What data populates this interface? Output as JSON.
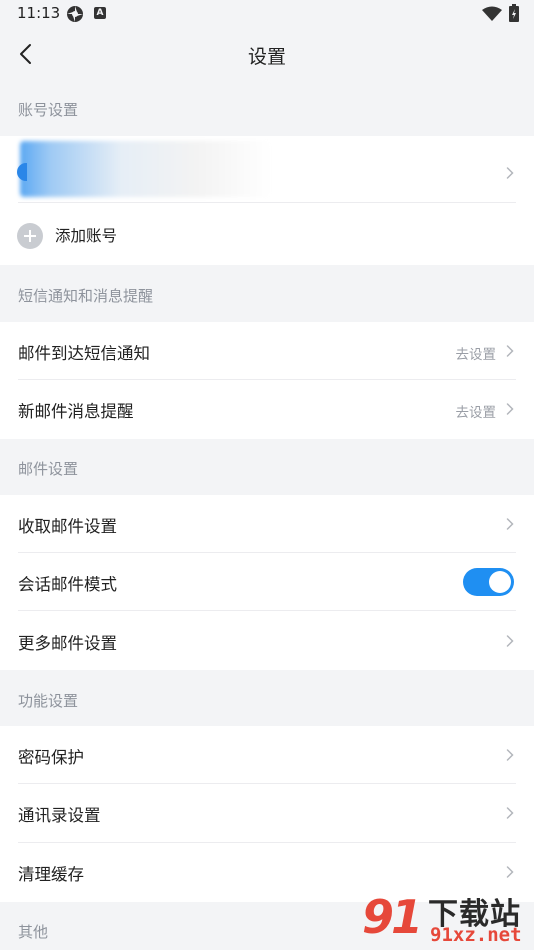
{
  "status_bar": {
    "time": "11:13",
    "app_badge": "A"
  },
  "header": {
    "title": "设置"
  },
  "sections": {
    "account": {
      "label": "账号设置",
      "add_account": "添加账号"
    },
    "sms": {
      "label": "短信通知和消息提醒",
      "rows": [
        {
          "title": "邮件到达短信通知",
          "value": "去设置"
        },
        {
          "title": "新邮件消息提醒",
          "value": "去设置"
        }
      ]
    },
    "mail": {
      "label": "邮件设置",
      "rows": [
        {
          "title": "收取邮件设置"
        },
        {
          "title": "会话邮件模式",
          "toggle_on": true
        },
        {
          "title": "更多邮件设置"
        }
      ]
    },
    "function": {
      "label": "功能设置",
      "rows": [
        {
          "title": "密码保护"
        },
        {
          "title": "通讯录设置"
        },
        {
          "title": "清理缓存"
        }
      ]
    },
    "other": {
      "label": "其他"
    }
  },
  "watermark": {
    "mark": "91",
    "title": "下载站",
    "url": "91xz.net"
  },
  "colors": {
    "accent": "#1f8ff2",
    "background": "#f3f4f6",
    "section_label": "#8e939c"
  }
}
